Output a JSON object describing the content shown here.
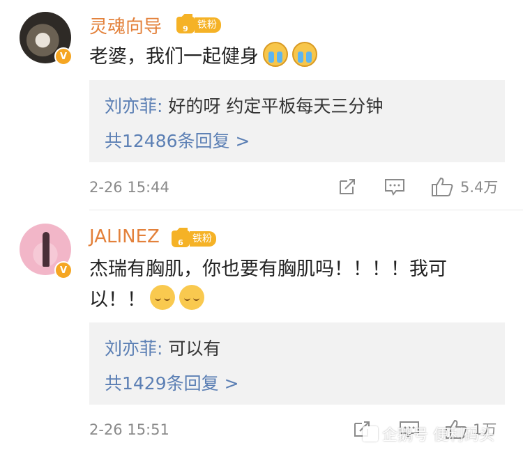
{
  "comments": [
    {
      "username": "灵魂向导",
      "fan_level": "9",
      "fan_label": "铁粉",
      "text": "老婆，我们一起健身",
      "reply": {
        "author": "刘亦菲:",
        "text": "好的呀 约定平板每天三分钟",
        "more": "共12486条回复 >"
      },
      "time": "2-26 15:44",
      "likes": "5.4万"
    },
    {
      "username": "JALINEZ",
      "fan_level": "6",
      "fan_label": "铁粉",
      "text": "杰瑞有胸肌，你也要有胸肌吗！！！！我可以！！",
      "reply": {
        "author": "刘亦菲:",
        "text": "可以有",
        "more": "共1429条回复 >"
      },
      "time": "2-26 15:51",
      "likes": "1万"
    }
  ],
  "watermark": "企鹅号 便利码头",
  "colors": {
    "username": "#e3813b",
    "link": "#5b7fb4",
    "badge": "#f5b226"
  }
}
